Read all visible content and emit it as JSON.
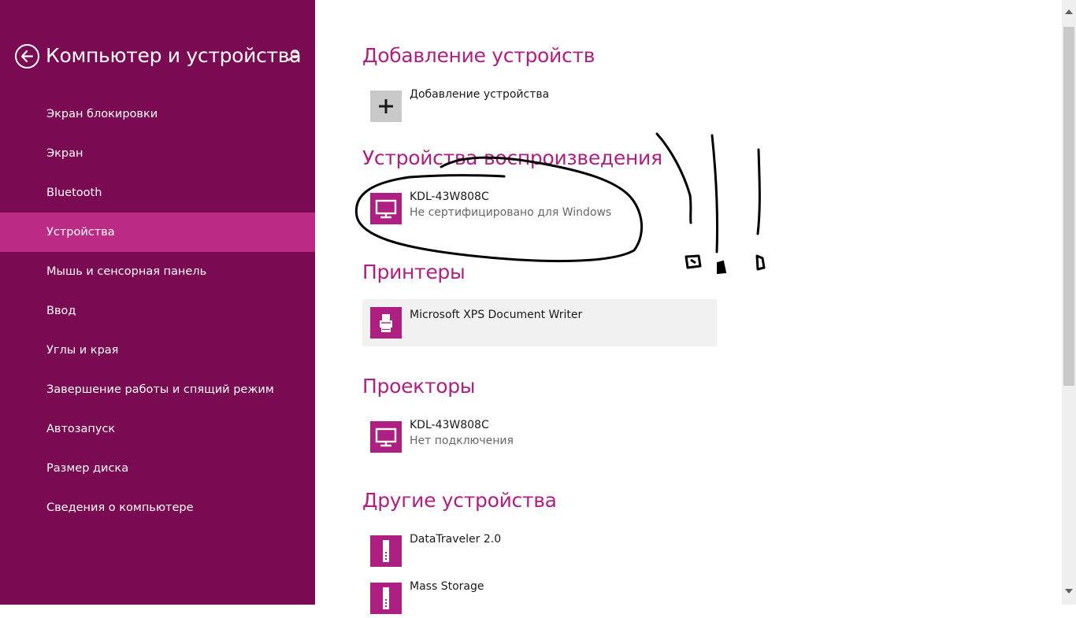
{
  "sidebar": {
    "title": "Компьютер и устройства",
    "items": [
      {
        "label": "Экран блокировки",
        "active": false
      },
      {
        "label": "Экран",
        "active": false
      },
      {
        "label": "Bluetooth",
        "active": false
      },
      {
        "label": "Устройства",
        "active": true
      },
      {
        "label": "Мышь и сенсорная панель",
        "active": false
      },
      {
        "label": "Ввод",
        "active": false
      },
      {
        "label": "Углы и края",
        "active": false
      },
      {
        "label": "Завершение работы и спящий режим",
        "active": false
      },
      {
        "label": "Автозапуск",
        "active": false
      },
      {
        "label": "Размер диска",
        "active": false
      },
      {
        "label": "Сведения о компьютере",
        "active": false
      }
    ]
  },
  "main": {
    "add_section": {
      "title": "Добавление устройств",
      "add_button_label": "Добавление устройства"
    },
    "playback_section": {
      "title": "Устройства воспроизведения",
      "devices": [
        {
          "name": "KDL-43W808C",
          "status": "Не сертифицировано для Windows",
          "icon": "monitor-icon"
        }
      ]
    },
    "printers_section": {
      "title": "Принтеры",
      "devices": [
        {
          "name": "Microsoft XPS Document Writer",
          "icon": "printer-icon"
        }
      ]
    },
    "projectors_section": {
      "title": "Проекторы",
      "devices": [
        {
          "name": "KDL-43W808C",
          "status": "Нет подключения",
          "icon": "monitor-icon"
        }
      ]
    },
    "other_section": {
      "title": "Другие устройства",
      "devices": [
        {
          "name": "DataTraveler 2.0",
          "icon": "usb-drive-icon"
        },
        {
          "name": "Mass Storage",
          "icon": "usb-drive-icon"
        }
      ]
    }
  },
  "colors": {
    "sidebar_bg": "#7a0a52",
    "sidebar_active": "#bc2b85",
    "accent": "#ad1f80",
    "selected_row": "#f1f1f1"
  },
  "icons": {
    "back": "back-arrow-icon",
    "search": "search-icon",
    "add": "plus-icon"
  }
}
